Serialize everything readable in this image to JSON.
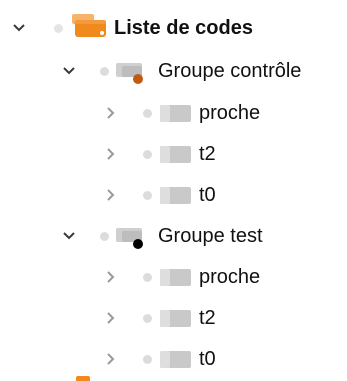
{
  "tree": {
    "root": {
      "label": "Liste de codes",
      "icon": "code-list-icon",
      "expanded": true,
      "accent_color": "#f08a1c"
    },
    "groups": [
      {
        "label": "Groupe contrôle",
        "icon": "code-group-icon",
        "marker_color": "#c05a10",
        "expanded": true,
        "children": [
          {
            "label": "proche",
            "icon": "code-icon",
            "expanded": false
          },
          {
            "label": "t2",
            "icon": "code-icon",
            "expanded": false
          },
          {
            "label": "t0",
            "icon": "code-icon",
            "expanded": false
          }
        ]
      },
      {
        "label": "Groupe test",
        "icon": "code-group-icon",
        "marker_color": "#000000",
        "expanded": true,
        "children": [
          {
            "label": "proche",
            "icon": "code-icon",
            "expanded": false
          },
          {
            "label": "t2",
            "icon": "code-icon",
            "expanded": false
          },
          {
            "label": "t0",
            "icon": "code-icon",
            "expanded": false
          }
        ]
      }
    ]
  }
}
